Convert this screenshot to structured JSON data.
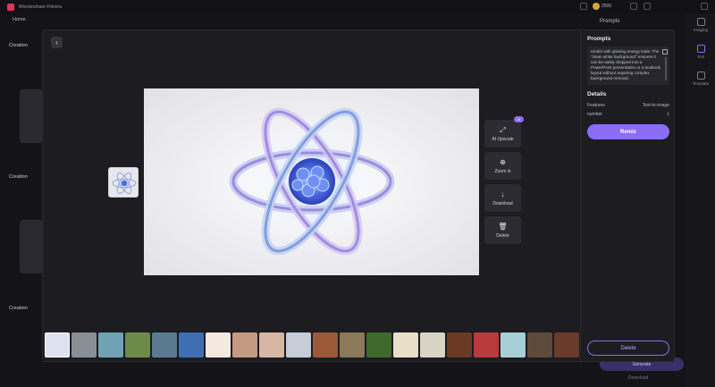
{
  "app": {
    "name": "Wondershare Filmora",
    "coins": "2500"
  },
  "nav": {
    "home": "Home"
  },
  "background": {
    "section_labels": [
      "Creation",
      "Creation",
      "Creation"
    ],
    "prompts_title": "Prompts",
    "generate_label": "Generate",
    "download_label": "Download"
  },
  "rail": {
    "items": [
      "Imaging",
      "Tool",
      "Template"
    ]
  },
  "viewer": {
    "actions": [
      {
        "label": "AI Upscale",
        "icon": "upscale-icon",
        "badge": "AI"
      },
      {
        "label": "Zoom in",
        "icon": "zoom-in-icon"
      },
      {
        "label": "Download",
        "icon": "download-icon"
      },
      {
        "label": "Delete",
        "icon": "trash-icon"
      }
    ]
  },
  "panel": {
    "prompts_title": "Prompts",
    "prompt_text": "render with glowing energy trails. The \"clean white background\" ensures it can be easily dropped into a PowerPoint presentation or a textbook layout without requiring complex background removal.",
    "details_title": "Details",
    "details": [
      {
        "label": "Features",
        "value": "Text-to-image"
      },
      {
        "label": "number",
        "value": "1"
      }
    ],
    "remix_label": "Remix",
    "delete_label": "Delete"
  },
  "thumbnails": [
    {
      "color": "#dfe2f0",
      "selected": true
    },
    {
      "color": "#8a8f96"
    },
    {
      "color": "#6fa3b4"
    },
    {
      "color": "#6c8a4a"
    },
    {
      "color": "#5a7a92"
    },
    {
      "color": "#3f6fb0"
    },
    {
      "color": "#f4e9e0"
    },
    {
      "color": "#c49a82"
    },
    {
      "color": "#d8b6a4"
    },
    {
      "color": "#c6cdd8"
    },
    {
      "color": "#9a5a3a"
    },
    {
      "color": "#8a7a5a"
    },
    {
      "color": "#3e6a2e"
    },
    {
      "color": "#e8dfc8"
    },
    {
      "color": "#d9d3c6"
    },
    {
      "color": "#6b3a22"
    },
    {
      "color": "#b83a3a"
    },
    {
      "color": "#a8cfd6"
    },
    {
      "color": "#5e4a3a"
    },
    {
      "color": "#6a3a2a"
    }
  ]
}
